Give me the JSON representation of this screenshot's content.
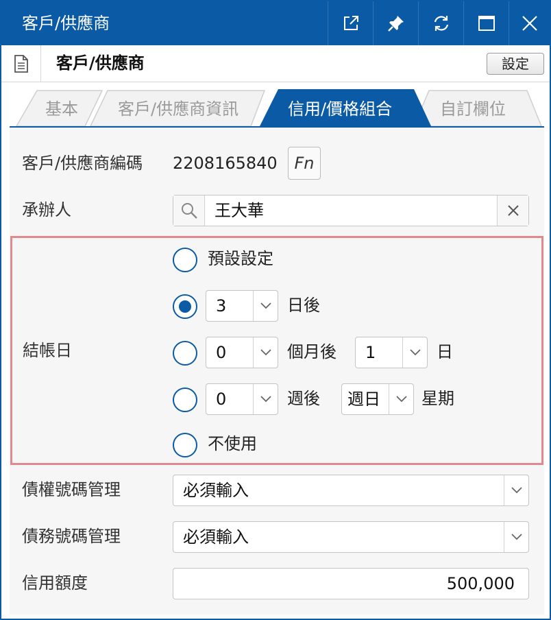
{
  "window": {
    "title": "客戶/供應商",
    "controls": [
      "popout-icon",
      "pin-icon",
      "refresh-icon",
      "maximize-icon",
      "close-icon"
    ]
  },
  "toolbar": {
    "title": "客戶/供應商",
    "settings_label": "設定"
  },
  "tabs": [
    {
      "label": "基本",
      "active": false
    },
    {
      "label": "客戶/供應商資訊",
      "active": false
    },
    {
      "label": "信用/價格組合",
      "active": true
    },
    {
      "label": "自訂欄位",
      "active": false
    }
  ],
  "form": {
    "code": {
      "label": "客戶/供應商編碼",
      "value": "2208165840",
      "fn_label": "Fn"
    },
    "handler": {
      "label": "承辦人",
      "value": "王大華"
    },
    "billing_day": {
      "label": "結帳日",
      "options": {
        "default": {
          "text": "預設設定",
          "checked": false
        },
        "days_after": {
          "value": "3",
          "suffix": "日後",
          "checked": true
        },
        "months_after": {
          "value": "0",
          "suffix": "個月後",
          "day_value": "1",
          "day_suffix": "日",
          "checked": false
        },
        "weeks_after": {
          "value": "0",
          "suffix": "週後",
          "weekday_value": "週日",
          "weekday_suffix": "星期",
          "checked": false
        },
        "unused": {
          "text": "不使用",
          "checked": false
        }
      }
    },
    "receivable_number": {
      "label": "債權號碼管理",
      "value": "必須輸入"
    },
    "payable_number": {
      "label": "債務號碼管理",
      "value": "必須輸入"
    },
    "credit_limit": {
      "label": "信用額度",
      "value": "500,000"
    }
  },
  "colors": {
    "accent": "#0a5aa6",
    "highlight_border": "#e0898e",
    "panel_bg": "#f6f6f6"
  }
}
